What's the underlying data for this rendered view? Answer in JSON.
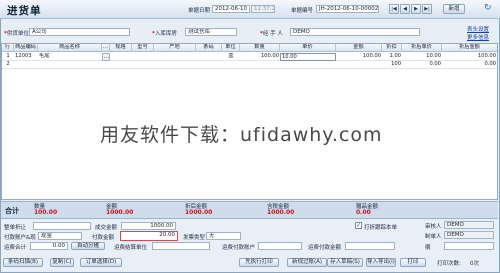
{
  "window": {
    "title": "进货单",
    "doc_date_label": "单据日期",
    "doc_date": "2012-06-10",
    "doc_time": "11:37:23",
    "doc_no_label": "单据编号",
    "doc_no": "JH-2012-06-10-00002",
    "nav": [
      "|◀",
      "◀",
      "▶",
      "▶|"
    ],
    "new_button": "新增",
    "refresh_icon": "↻"
  },
  "header": {
    "supplier_label": "供货单位",
    "supplier": "A公司",
    "warehouse_label": "入库库房",
    "warehouse": "测试仓库",
    "handler_label": "经 手 人",
    "handler": "DEMO",
    "link_settings": "表头设置",
    "link_more": "更多信息"
  },
  "table": {
    "columns": [
      "行",
      "商品编码",
      "商品名称",
      "…",
      "规格",
      "型号",
      "产地",
      "条码",
      "单位",
      "数量",
      "单价",
      "金额",
      "折扣",
      "折后单价",
      "折后金额"
    ],
    "rows": [
      {
        "row": "1",
        "code": "12003",
        "name": "毛尾",
        "unit": "盒",
        "qty": "100.00",
        "price": "10.00",
        "amount": "100.00",
        "discount": "1.00",
        "disc_price": "10.00",
        "disc_amount": "100.00"
      }
    ],
    "total_row": {
      "qty": "100",
      "discount": "",
      "amount": "0.00",
      "disc_amount": "0.00"
    }
  },
  "watermark": "用友软件下载：ufidawhy.com",
  "summary": {
    "total_label": "合计",
    "qty_label": "数量",
    "qty": "100.00",
    "amount_label": "金额",
    "amount": "1000.00",
    "disc_amount_label": "折后金额",
    "disc_amount": "1000.00",
    "tax_amount_label": "含税金额",
    "tax_amount": "1000.00",
    "gift_qty_label": "赠品金额",
    "gift_qty": "0.00"
  },
  "footer": {
    "whole_discount_label": "整单折让",
    "whole_discount": "",
    "deal_amount_label": "成交金额",
    "deal_amount": "1000.00",
    "follow_checkbox_label": "打折跟踪本单",
    "pay_account_label": "付款账户&现",
    "pay_account": "现金",
    "pay_amount_label": "付款金额",
    "pay_amount": "20.00",
    "invoice_type_label": "发票类型",
    "invoice_type": "无",
    "fee_total_label": "运费合计",
    "fee_total": "0.00",
    "auto_share_label": "自动分摊",
    "fee_unit_label": "运费结算单位",
    "fee_unit": "",
    "fee_pay_account_label": "运费付款账户",
    "fee_pay_account": "",
    "fee_pay_amount_label": "运费付款金额",
    "fee_pay_amount": "",
    "auditor_label": "审核人",
    "auditor": "DEMO",
    "maker_label": "制单人",
    "maker": "DEMO",
    "remark_label": "摘",
    "remark": ""
  },
  "actions": {
    "scan": "条码扫描(B)",
    "copy": "复制(C)",
    "order": "订单选择(D)",
    "print_reprint": "先执行打印",
    "new_default": "新规过账(A)",
    "save_draft": "存入草稿(S)",
    "import": "导入导出(I)",
    "print": "打印",
    "print_count_label": "打印次数:",
    "print_count": "0次"
  }
}
